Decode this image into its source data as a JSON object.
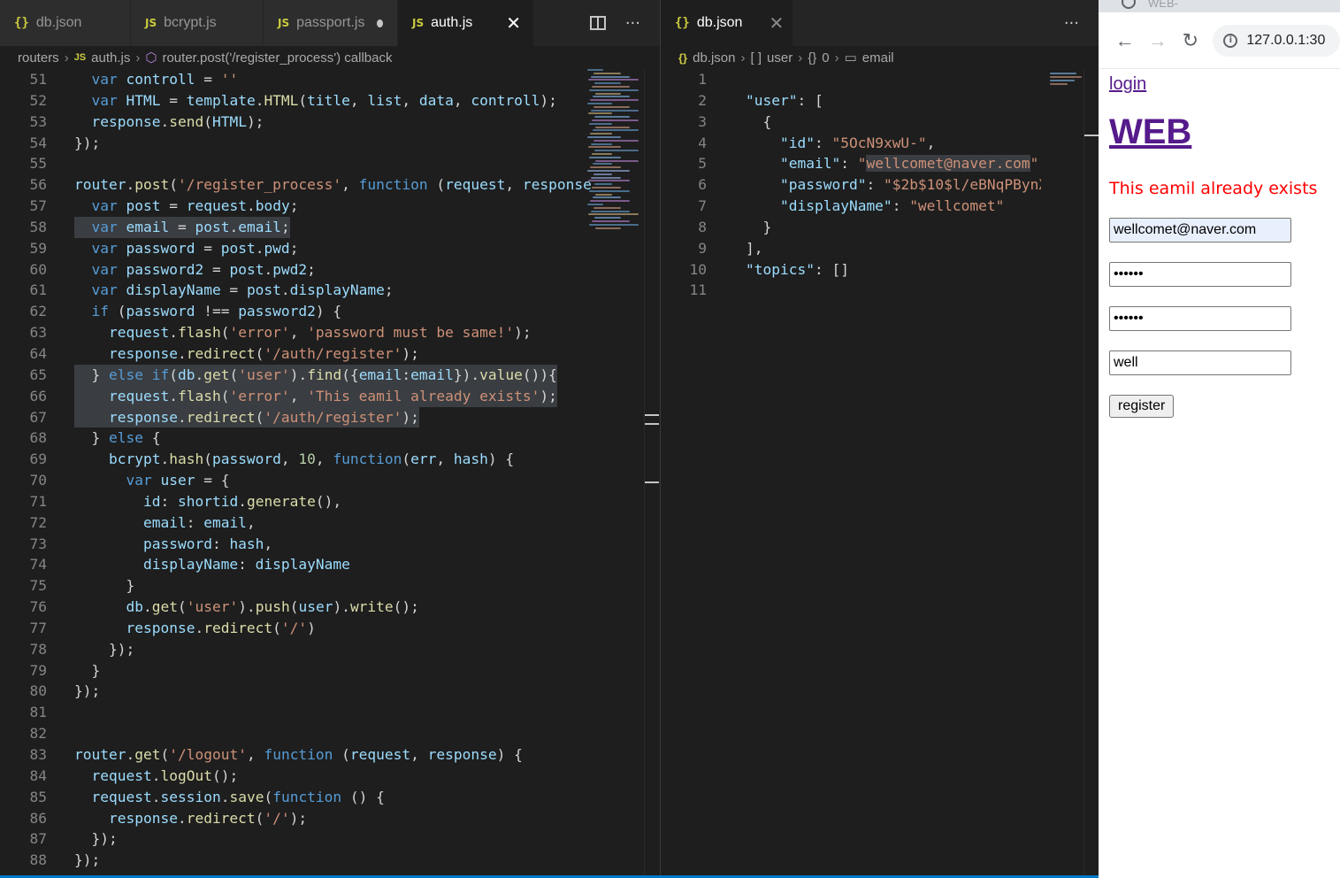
{
  "left_editor": {
    "tabs": [
      {
        "icon": "{}",
        "label": "db.json"
      },
      {
        "icon": "JS",
        "label": "bcrypt.js"
      },
      {
        "icon": "JS",
        "label": "passport.js"
      },
      {
        "icon": "JS",
        "label": "auth.js"
      }
    ],
    "more": "···",
    "breadcrumb": {
      "folder": "routers",
      "file": "auth.js",
      "symbol": "router.post('/register_process') callback"
    },
    "line_numbers": [
      "51",
      "52",
      "53",
      "54",
      "55",
      "56",
      "57",
      "58",
      "59",
      "60",
      "61",
      "62",
      "63",
      "64",
      "65",
      "66",
      "67",
      "68",
      "69",
      "70",
      "71",
      "72",
      "73",
      "74",
      "75",
      "76",
      "77",
      "78",
      "79",
      "80",
      "81",
      "82",
      "83",
      "84",
      "85",
      "86",
      "87",
      "88"
    ],
    "code": {
      "l51": [
        "  var ",
        "controll",
        " = ",
        "''"
      ],
      "l52": [
        "  var ",
        "HTML",
        " = ",
        "template",
        ".",
        "HTML",
        "(",
        "title",
        ", ",
        "list",
        ", ",
        "data",
        ", ",
        "controll",
        ");"
      ],
      "l53": [
        "  ",
        "response",
        ".",
        "send",
        "(",
        "HTML",
        ");"
      ],
      "l54": [
        "});"
      ],
      "l56": [
        "router",
        ".",
        "post",
        "(",
        "'/register_process'",
        ", ",
        "function",
        " (",
        "request",
        ", ",
        "response"
      ],
      "l57": [
        "  var ",
        "post",
        " = ",
        "request",
        ".",
        "body",
        ";"
      ],
      "l58": [
        "  var ",
        "email",
        " = ",
        "post",
        ".",
        "email",
        ";"
      ],
      "l59": [
        "  var ",
        "password",
        " = ",
        "post",
        ".",
        "pwd",
        ";"
      ],
      "l60": [
        "  var ",
        "password2",
        " = ",
        "post",
        ".",
        "pwd2",
        ";"
      ],
      "l61": [
        "  var ",
        "displayName",
        " = ",
        "post",
        ".",
        "displayName",
        ";"
      ],
      "l62": [
        "  if ",
        "(",
        "password",
        " !== ",
        "password2",
        ") {"
      ],
      "l63": [
        "    ",
        "request",
        ".",
        "flash",
        "(",
        "'error'",
        ", ",
        "'password must be same!'",
        ");"
      ],
      "l64": [
        "    ",
        "response",
        ".",
        "redirect",
        "(",
        "'/auth/register'",
        ");"
      ],
      "l65": [
        "  } ",
        "else if",
        "(",
        "db",
        ".",
        "get",
        "(",
        "'user'",
        ").",
        "find",
        "({",
        "email",
        ":",
        "email",
        "}).",
        "value",
        "()){"
      ],
      "l66": [
        "    ",
        "request",
        ".",
        "flash",
        "(",
        "'error'",
        ", ",
        "'This eamil already exists'",
        ");"
      ],
      "l67": [
        "    ",
        "response",
        ".",
        "redirect",
        "(",
        "'/auth/register'",
        ");"
      ],
      "l68": [
        "  } ",
        "else",
        " {"
      ],
      "l69": [
        "    ",
        "bcrypt",
        ".",
        "hash",
        "(",
        "password",
        ", ",
        "10",
        ", ",
        "function",
        "(",
        "err",
        ", ",
        "hash",
        ") {"
      ],
      "l70": [
        "      var ",
        "user",
        " = {"
      ],
      "l71": [
        "        ",
        "id",
        ": ",
        "shortid",
        ".",
        "generate",
        "(),"
      ],
      "l72": [
        "        ",
        "email",
        ": ",
        "email",
        ","
      ],
      "l73": [
        "        ",
        "password",
        ": ",
        "hash",
        ","
      ],
      "l74": [
        "        ",
        "displayName",
        ": ",
        "displayName"
      ],
      "l75": [
        "      }"
      ],
      "l76": [
        "      ",
        "db",
        ".",
        "get",
        "(",
        "'user'",
        ").",
        "push",
        "(",
        "user",
        ").",
        "write",
        "();"
      ],
      "l77": [
        "      ",
        "response",
        ".",
        "redirect",
        "(",
        "'/'",
        ")"
      ],
      "l78": [
        "    });"
      ],
      "l79": [
        "  }"
      ],
      "l80": [
        "});"
      ],
      "l83": [
        "router",
        ".",
        "get",
        "(",
        "'/logout'",
        ", ",
        "function",
        " (",
        "request",
        ", ",
        "response",
        ") {"
      ],
      "l84": [
        "  ",
        "request",
        ".",
        "logOut",
        "();"
      ],
      "l85": [
        "  ",
        "request",
        ".",
        "session",
        ".",
        "save",
        "(",
        "function",
        " () {"
      ],
      "l86": [
        "    ",
        "response",
        ".",
        "redirect",
        "(",
        "'/'",
        ");"
      ],
      "l87": [
        "  });"
      ],
      "l88": [
        "});"
      ]
    }
  },
  "right_editor": {
    "tab": {
      "icon": "{}",
      "label": "db.json"
    },
    "more": "···",
    "breadcrumb": [
      "db.json",
      "user",
      "0",
      "email"
    ],
    "line_numbers": [
      "1",
      "2",
      "3",
      "4",
      "5",
      "6",
      "7",
      "8",
      "9",
      "10",
      "11"
    ],
    "json": {
      "l2": [
        "\"user\"",
        ": ["
      ],
      "l3": [
        "{"
      ],
      "l4": [
        "\"id\"",
        ": ",
        "\"5OcN9xwU-\"",
        ","
      ],
      "l5": [
        "\"email\"",
        ": ",
        "\"",
        "wellcomet@naver.com",
        "\"",
        ","
      ],
      "l6": [
        "\"password\"",
        ": ",
        "\"$2b$10$l/eBNqPBynX"
      ],
      "l7": [
        "\"displayName\"",
        ": ",
        "\"wellcomet\""
      ],
      "l8": [
        "}"
      ],
      "l9": [
        "],"
      ],
      "l10": [
        "\"topics\"",
        ": []"
      ]
    }
  },
  "browser": {
    "tab_title": "WEB-",
    "url": "127.0.0.1:30",
    "page": {
      "login_link": "login",
      "title": "WEB",
      "error": "This eamil already exists",
      "email_value": "wellcomet@naver.com",
      "password_value": "••••••",
      "password2_value": "••••••",
      "display_name_value": "well",
      "register_label": "register"
    }
  },
  "colors": {
    "keyword": "#569cd6",
    "variable": "#9cdcfe",
    "function": "#dcdcaa",
    "string": "#ce9178",
    "number": "#b5cea8",
    "error_text": "#ff0000",
    "link_visited": "#551a8b"
  }
}
